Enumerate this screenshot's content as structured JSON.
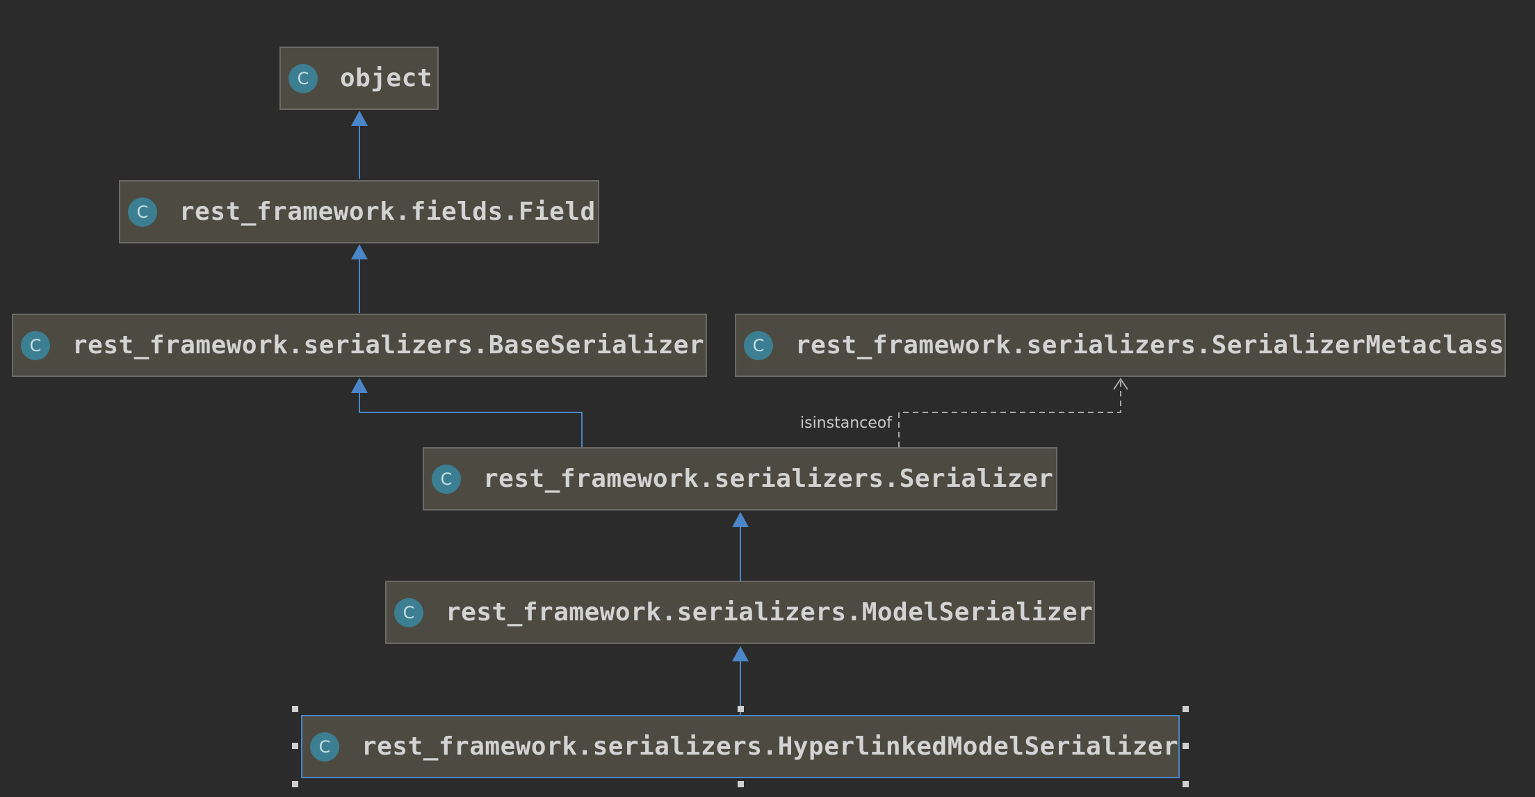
{
  "diagram": {
    "icon_letter": "C",
    "nodes": [
      {
        "id": "object",
        "label": "object"
      },
      {
        "id": "field",
        "label": "rest_framework.fields.Field"
      },
      {
        "id": "base_serializer",
        "label": "rest_framework.serializers.BaseSerializer"
      },
      {
        "id": "serializer_metaclass",
        "label": "rest_framework.serializers.SerializerMetaclass"
      },
      {
        "id": "serializer",
        "label": "rest_framework.serializers.Serializer"
      },
      {
        "id": "model_serializer",
        "label": "rest_framework.serializers.ModelSerializer"
      },
      {
        "id": "hyperlinked_model_serializer",
        "label": "rest_framework.serializers.HyperlinkedModelSerializer",
        "selected": true
      }
    ],
    "edges": [
      {
        "from": "field",
        "to": "object",
        "kind": "inheritance"
      },
      {
        "from": "base_serializer",
        "to": "field",
        "kind": "inheritance"
      },
      {
        "from": "serializer",
        "to": "base_serializer",
        "kind": "inheritance"
      },
      {
        "from": "serializer",
        "to": "serializer_metaclass",
        "kind": "isinstanceof",
        "label": "isinstanceof"
      },
      {
        "from": "model_serializer",
        "to": "serializer",
        "kind": "inheritance"
      },
      {
        "from": "hyperlinked_model_serializer",
        "to": "model_serializer",
        "kind": "inheritance"
      }
    ],
    "colors": {
      "background": "#2b2b2b",
      "node_fill": "#4d4a42",
      "node_border": "#6b6a66",
      "selected_border": "#4a86c8",
      "class_icon": "#3c7f92",
      "inheritance_edge": "#4a86c8",
      "dependency_edge": "#a9a9a9"
    }
  }
}
